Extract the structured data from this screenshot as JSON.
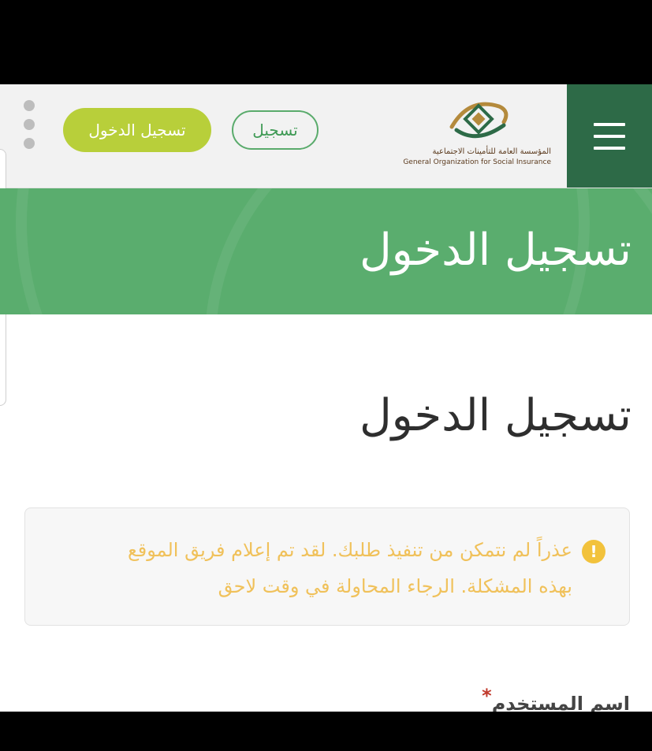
{
  "header": {
    "logo_ar": "المؤسسة العامة للتأمينات الاجتماعية",
    "logo_en": "General Organization for Social Insurance",
    "register_label": "تسجيل",
    "login_label": "تسجيل الدخول",
    "menu_icon": "hamburger-menu-icon",
    "more_icon": "more-vertical-icon"
  },
  "banner": {
    "title": "تسجيل الدخول"
  },
  "main": {
    "page_title": "تسجيل الدخول",
    "alert": {
      "icon": "warning-icon",
      "icon_glyph": "!",
      "message": "عذراً لم نتمكن من تنفيذ طلبك. لقد تم إعلام فريق الموقع بهذه المشكلة. الرجاء المحاولة في وقت لاحق"
    },
    "username_label": "اسم المستخدم",
    "required_mark": "*"
  },
  "colors": {
    "brand_dark_green": "#2d6a47",
    "banner_green": "#5aad6e",
    "login_button": "#b8cf3a",
    "alert_text": "#f0c15a"
  }
}
